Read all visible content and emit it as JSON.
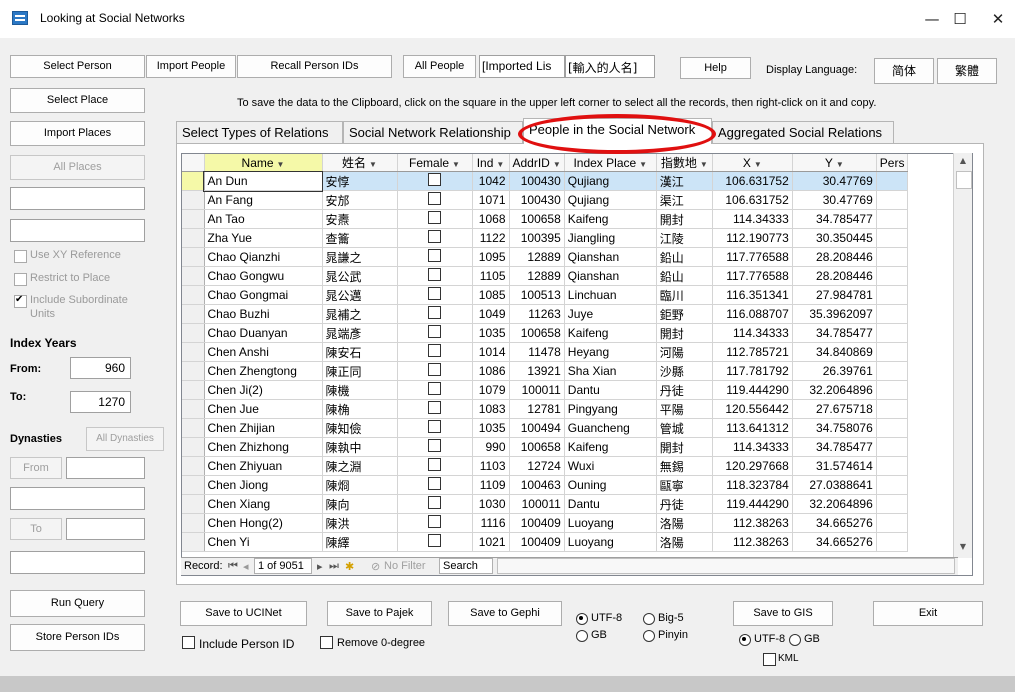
{
  "window": {
    "title": "Looking at Social Networks",
    "minimize": "—",
    "maximize": "☐",
    "close": "✕"
  },
  "toolbar": {
    "select_person": "Select Person",
    "import_people": "Import People",
    "recall_person_ids": "Recall Person IDs",
    "all_people": "All People",
    "imported_list_en": "[Imported Lis",
    "imported_list_zh": "[輸入的人名]",
    "help": "Help",
    "display_language": "Display Language:",
    "simplified": "简体",
    "traditional": "繁體"
  },
  "left": {
    "select_place": "Select Place",
    "import_places": "Import Places",
    "all_places": "All Places",
    "use_xy_reference": "Use XY Reference",
    "restrict_to_place": "Restrict to Place",
    "include_subordinate": "Include Subordinate",
    "units": "Units",
    "index_years": "Index Years",
    "from_label": "From:",
    "from_value": "960",
    "to_label": "To:",
    "to_value": "1270",
    "dynasties": "Dynasties",
    "all_dynasties": "All Dynasties",
    "from_btn": "From",
    "to_btn": "To",
    "run_query": "Run Query",
    "store_person_ids": "Store Person IDs"
  },
  "clipboard_hint": "To save the data to the Clipboard, click on the square in the upper left corner to select all the records, then right-click on it and copy.",
  "tabs": [
    {
      "label": "Select Types of Relations"
    },
    {
      "label": "Social Network Relationship"
    },
    {
      "label": "People in the Social Network"
    },
    {
      "label": "Aggregated Social Relations"
    }
  ],
  "columns": [
    "Name",
    "姓名",
    "Female",
    "Ind",
    "AddrID",
    "Index Place",
    "指數地",
    "X",
    "Y",
    "Pers"
  ],
  "rows": [
    [
      "An Dun",
      "安惇",
      "",
      "1042",
      "100430",
      "Qujiang",
      "漢江",
      "106.631752",
      "30.47769"
    ],
    [
      "An Fang",
      "安邡",
      "",
      "1071",
      "100430",
      "Qujiang",
      "渠江",
      "106.631752",
      "30.47769"
    ],
    [
      "An Tao",
      "安燾",
      "",
      "1068",
      "100658",
      "Kaifeng",
      "開封",
      "114.34333",
      "34.785477"
    ],
    [
      "Zha Yue",
      "查籥",
      "",
      "1122",
      "100395",
      "Jiangling",
      "江陵",
      "112.190773",
      "30.350445"
    ],
    [
      "Chao Qianzhi",
      "晁謙之",
      "",
      "1095",
      "12889",
      "Qianshan",
      "鉛山",
      "117.776588",
      "28.208446"
    ],
    [
      "Chao Gongwu",
      "晁公武",
      "",
      "1105",
      "12889",
      "Qianshan",
      "鉛山",
      "117.776588",
      "28.208446"
    ],
    [
      "Chao Gongmai",
      "晁公邁",
      "",
      "1085",
      "100513",
      "Linchuan",
      "臨川",
      "116.351341",
      "27.984781"
    ],
    [
      "Chao Buzhi",
      "晁補之",
      "",
      "1049",
      "11263",
      "Juye",
      "鉅野",
      "116.088707",
      "35.3962097"
    ],
    [
      "Chao Duanyan",
      "晁端彥",
      "",
      "1035",
      "100658",
      "Kaifeng",
      "開封",
      "114.34333",
      "34.785477"
    ],
    [
      "Chen Anshi",
      "陳安石",
      "",
      "1014",
      "11478",
      "Heyang",
      "河陽",
      "112.785721",
      "34.840869"
    ],
    [
      "Chen Zhengtong",
      "陳正同",
      "",
      "1086",
      "13921",
      "Sha Xian",
      "沙縣",
      "117.781792",
      "26.39761"
    ],
    [
      "Chen Ji(2)",
      "陳機",
      "",
      "1079",
      "100011",
      "Dantu",
      "丹徒",
      "119.444290",
      "32.2064896"
    ],
    [
      "Chen Jue",
      "陳桷",
      "",
      "1083",
      "12781",
      "Pingyang",
      "平陽",
      "120.556442",
      "27.675718"
    ],
    [
      "Chen Zhijian",
      "陳知儉",
      "",
      "1035",
      "100494",
      "Guancheng",
      "管城",
      "113.641312",
      "34.758076"
    ],
    [
      "Chen Zhizhong",
      "陳執中",
      "",
      "990",
      "100658",
      "Kaifeng",
      "開封",
      "114.34333",
      "34.785477"
    ],
    [
      "Chen Zhiyuan",
      "陳之淵",
      "",
      "1103",
      "12724",
      "Wuxi",
      "無錫",
      "120.297668",
      "31.574614"
    ],
    [
      "Chen Jiong",
      "陳烱",
      "",
      "1109",
      "100463",
      "Ouning",
      "甌寧",
      "118.323784",
      "27.0388641"
    ],
    [
      "Chen Xiang",
      "陳向",
      "",
      "1030",
      "100011",
      "Dantu",
      "丹徒",
      "119.444290",
      "32.2064896"
    ],
    [
      "Chen Hong(2)",
      "陳洪",
      "",
      "1116",
      "100409",
      "Luoyang",
      "洛陽",
      "112.38263",
      "34.665276"
    ],
    [
      "Chen Yi",
      "陳繹",
      "",
      "1021",
      "100409",
      "Luoyang",
      "洛陽",
      "112.38263",
      "34.665276"
    ]
  ],
  "record_bar": {
    "record_label": "Record:",
    "position": "1 of 9051",
    "no_filter": "No Filter",
    "search": "Search"
  },
  "bottom": {
    "save_ucinet": "Save to UCINet",
    "save_pajek": "Save to Pajek",
    "save_gephi": "Save to Gephi",
    "utf8": "UTF-8",
    "big5": "Big-5",
    "gb": "GB",
    "pinyin": "Pinyin",
    "save_gis": "Save to GIS",
    "gis_utf8": "UTF-8",
    "gis_gb": "GB",
    "kml": "KML",
    "exit": "Exit",
    "include_person_id": "Include Person ID",
    "remove_0_degree": "Remove 0-degree"
  }
}
